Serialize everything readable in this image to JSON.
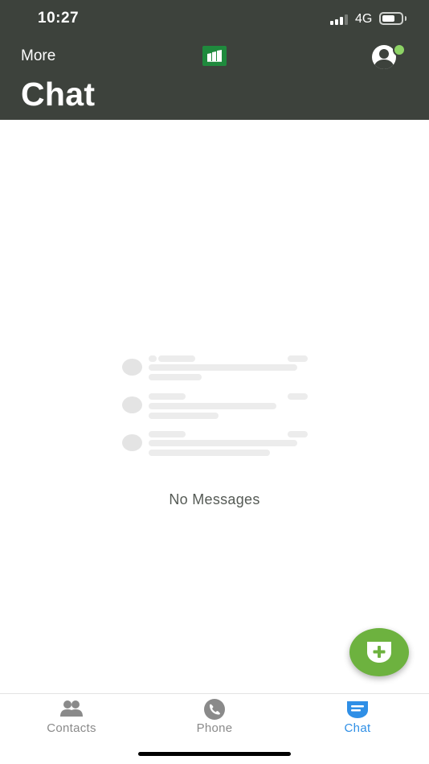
{
  "status_bar": {
    "time": "10:27",
    "network": "4G",
    "battery_level": 0.7
  },
  "header": {
    "more_label": "More",
    "title": "Chat",
    "logo_icon": "app-logo-icon",
    "profile_icon": "profile-icon",
    "presence_color": "#8dd365"
  },
  "empty_state": {
    "label": "No Messages"
  },
  "fab": {
    "icon": "new-chat-icon",
    "color": "#6db23f"
  },
  "tabs": [
    {
      "label": "Contacts",
      "icon": "contacts-icon",
      "active": false
    },
    {
      "label": "Phone",
      "icon": "phone-icon",
      "active": false
    },
    {
      "label": "Chat",
      "icon": "chat-icon",
      "active": true
    }
  ],
  "colors": {
    "header_bg": "#3d423c",
    "active_tab": "#2f8fe6",
    "inactive_tab": "#8a8a8a"
  }
}
